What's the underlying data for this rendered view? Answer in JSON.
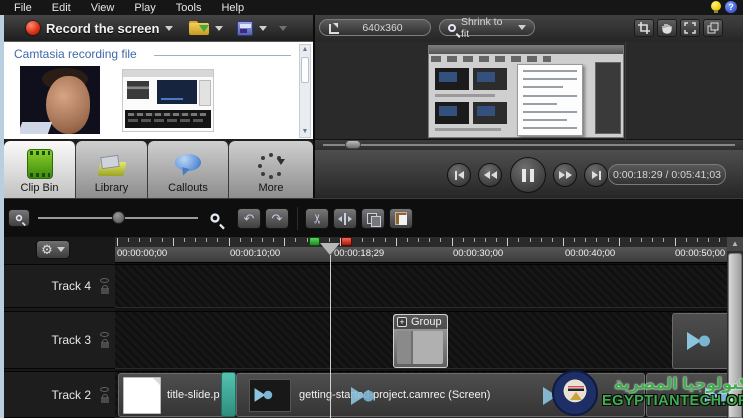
{
  "menu": {
    "items": [
      "File",
      "Edit",
      "View",
      "Play",
      "Tools",
      "Help"
    ]
  },
  "record_toolbar": {
    "record_label": "Record the screen"
  },
  "clip_bin": {
    "header": "Camtasia recording file"
  },
  "tabs": [
    {
      "label": "Clip Bin"
    },
    {
      "label": "Library"
    },
    {
      "label": "Callouts"
    },
    {
      "label": "More"
    }
  ],
  "preview": {
    "dimensions": "640x360",
    "zoom_mode": "Shrink to fit",
    "time_display": "0:00:18:29 / 0:05:41;03"
  },
  "timeline": {
    "ruler_labels": [
      "00:00:00;00",
      "00:00:10;00",
      "00:00:30;00",
      "00:00:40;00",
      "00:00:50;00"
    ],
    "playhead_time": "00:00:18;29",
    "tracks": [
      {
        "name": "Track 4"
      },
      {
        "name": "Track 3"
      },
      {
        "name": "Track 2"
      }
    ],
    "clips": {
      "group": "Group",
      "title_slide": "title-slide.p",
      "screen": "getting-started-project.camrec (Screen)"
    }
  },
  "watermark": {
    "arabic": "لتكنولوجيا المصرية",
    "site": "EGYPTIANTECH.ORG"
  },
  "icons": {
    "help": "?",
    "plus": "+",
    "gear": "⚙",
    "undo": "↶",
    "redo": "↷",
    "scissors": "✂",
    "up_arrow": "▲"
  },
  "colors": {
    "accent_blue": "#3f68a8",
    "teal": "#35a695",
    "arrow_blue": "#82bfdc",
    "record_red": "#d42314",
    "watermark_green": "#3fae4e"
  }
}
